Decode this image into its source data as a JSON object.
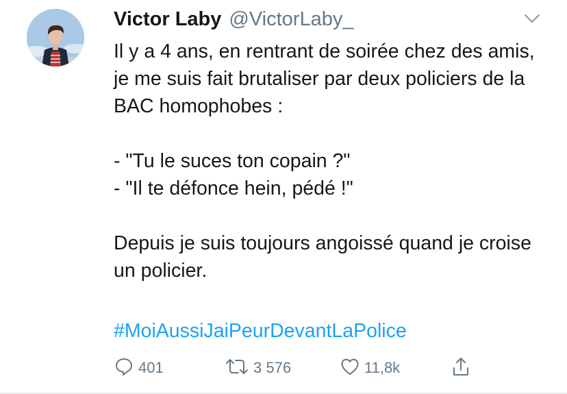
{
  "tweet": {
    "author_name": "Victor Laby",
    "author_handle": "@VictorLaby_",
    "paragraph1": "Il y a 4 ans, en rentrant de soirée chez des amis, je me suis fait brutaliser par deux policiers de la BAC homophobes :",
    "quote1": "- \"Tu le suces ton copain ?\"",
    "quote2": "- \"Il te défonce hein, pédé !\"",
    "paragraph3": "Depuis je suis toujours angoissé quand je croise un policier.",
    "hashtag": "#MoiAussiJaiPeurDevantLaPolice",
    "hashtag_color": "#1da1f2"
  },
  "actions": {
    "reply_count": "401",
    "retweet_count": "3 576",
    "like_count": "11,8k",
    "icons": [
      "reply-icon",
      "retweet-icon",
      "like-icon",
      "share-icon"
    ]
  },
  "colors": {
    "text": "#14171a",
    "secondary": "#657786",
    "accent": "#1da1f2"
  }
}
